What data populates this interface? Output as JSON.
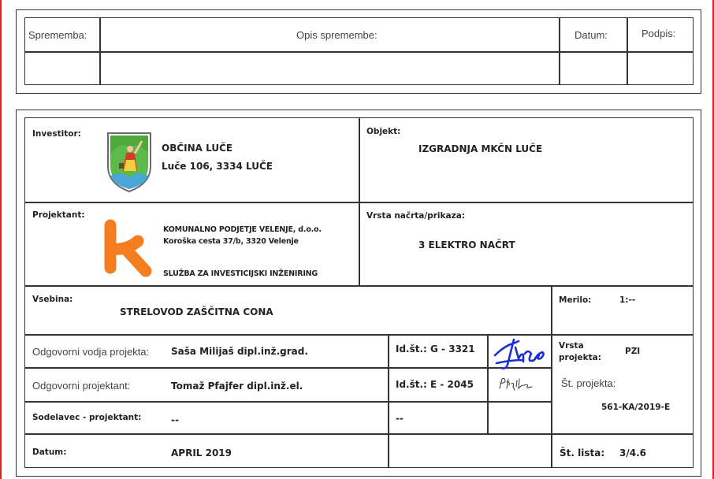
{
  "revision_table": {
    "col_change": "Sprememba:",
    "col_description": "Opis spremembe:",
    "col_date": "Datum:",
    "col_signature": "Podpis:"
  },
  "title_block": {
    "investor_label": "Investitor:",
    "investor_name": "OBČINA LUČE",
    "investor_address": "Luče 106, 3334 LUČE",
    "object_label": "Objekt:",
    "object_value": "IZGRADNJA MKČN LUČE",
    "designer_label": "Projektant:",
    "designer_name": "KOMUNALNO PODJETJE VELENJE, d.o.o.",
    "designer_address": "Koroška cesta 37/b, 3320 Velenje",
    "designer_department": "SLUŽBA ZA INVESTICIJSKI INŽENIRING",
    "drawing_type_label": "Vrsta načrta/prikaza:",
    "drawing_type_value": "3 ELEKTRO NAČRT",
    "content_label": "Vsebina:",
    "content_value": "STRELOVOD ZAŠČITNA CONA",
    "scale_label": "Merilo:",
    "scale_value": "1:--",
    "lead_designer_label": "Odgovorni vodja projekta:",
    "lead_designer_name": "Saša Milijaš dipl.inž.grad.",
    "lead_designer_id": "Id.št.: G - 3321",
    "project_type_label_1": "Vrsta",
    "project_type_label_2": "projekta:",
    "project_type_value": "PZI",
    "responsible_designer_label": "Odgovorni projektant:",
    "responsible_designer_name": "Tomaž Pfajfer dipl.inž.el.",
    "responsible_designer_id": "Id.št.: E - 2045",
    "project_no_label": "Št. projekta:",
    "project_no_value": "561-KA/2019-E",
    "collaborator_label": "Sodelavec - projektant:",
    "collaborator_value": "--",
    "collaborator_id": "--",
    "date_label": "Datum:",
    "date_value": "APRIL 2019",
    "sheet_label": "Št. lista:",
    "sheet_value": "3/4.6"
  },
  "colors": {
    "logo_orange": "#f47d20",
    "signature_blue": "#1a2fd8",
    "crest_green": "#4ea83a",
    "margin_red": "#e02020"
  }
}
